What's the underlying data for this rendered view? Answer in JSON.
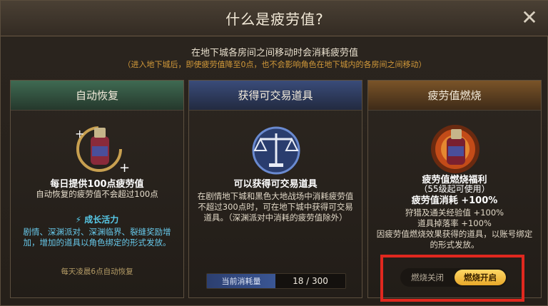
{
  "dialog": {
    "title": "什么是疲劳值?",
    "close_glyph": "✕",
    "intro_line1": "在地下城各房间之间移动时会消耗疲劳值",
    "intro_line2": "（进入地下城后，即使疲劳值降至0点，也不会影响角色在地下城内的各房间之间移动）"
  },
  "cards": {
    "recovery": {
      "header": "自动恢复",
      "title": "每日提供100点疲劳值",
      "subtitle": "自动恢复的疲劳值不会超过100点",
      "growth_label": "成长活力",
      "growth_icon": "lightning-icon",
      "growth_text": "剧情、深渊派对、深渊临界、裂缝奖励增加，增加的道具以角色绑定的形式发放。",
      "daily_note": "每天凌晨6点自动恢复"
    },
    "tradable": {
      "header": "获得可交易道具",
      "title": "可以获得可交易道具",
      "body": "在剧情地下城和黑色大地战场中消耗疲劳值不超过300点时，可在地下城中获得可交易道具。（深渊派对中消耗的疲劳值除外）",
      "meter_label": "当前消耗量",
      "meter_value": "18 / 300",
      "meter_current": 18,
      "meter_max": 300
    },
    "burn": {
      "header": "疲劳值燃烧",
      "title": "疲劳值燃烧福利",
      "level_note": "（55级起可使用）",
      "consume": "疲劳值消耗 +100%",
      "exp_bonus": "狩猎及通关经验值 +100%",
      "drop_bonus": "道具掉落率 +100%",
      "note": "因疲劳值燃烧效果获得的道具，以账号绑定的形式发放。",
      "toggle_off": "燃烧关闭",
      "toggle_on": "燃烧开启"
    }
  },
  "colors": {
    "accent_gold": "#e8a82a",
    "highlight_red": "#e0281f",
    "growth_blue": "#57c9e8",
    "note_orange": "#d39a3a"
  }
}
